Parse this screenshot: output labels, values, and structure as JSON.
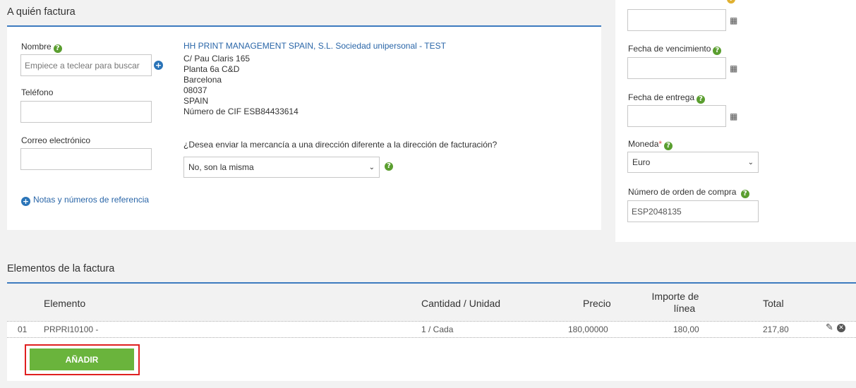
{
  "bill_to": {
    "title": "A quién factura",
    "name_label": "Nombre",
    "name_placeholder": "Empiece a teclear para buscar",
    "phone_label": "Teléfono",
    "phone_value": "",
    "email_label": "Correo electrónico",
    "email_value": "",
    "notes_link": "Notas y números de referencia",
    "company_name": "HH PRINT MANAGEMENT SPAIN, S.L. Sociedad unipersonal - TEST",
    "address_lines": [
      "C/ Pau Claris 165",
      "Planta 6a C&D",
      "Barcelona",
      "08037",
      "SPAIN",
      "Número de CIF ESB84433614"
    ],
    "ship_question": "¿Desea enviar la mercancía a una dirección diferente a la dirección de facturación?",
    "ship_selected": "No, son la misma"
  },
  "right_panel": {
    "due_date_label": "Fecha de vencimiento",
    "delivery_date_label": "Fecha de entrega",
    "currency_label": "Moneda",
    "currency_required_mark": "*",
    "currency_value": "Euro",
    "po_label": "Número de orden de compra",
    "po_value": "ESP2048135"
  },
  "items": {
    "title": "Elementos de la factura",
    "headers": {
      "element": "Elemento",
      "qty_unit": "Cantidad / Unidad",
      "price": "Precio",
      "line_amount_1": "Importe de",
      "line_amount_2": "línea",
      "total": "Total"
    },
    "rows": [
      {
        "num": "01",
        "element": "PRPRI10100 -",
        "qty_unit": "1 / Cada",
        "price": "180,00000",
        "line_amount": "180,00",
        "total": "217,80"
      }
    ],
    "add_button": "AÑADIR"
  },
  "icons": {
    "help": "question-circle-icon",
    "add": "plus-circle-icon",
    "calendar": "calendar-icon",
    "edit": "edit-icon",
    "delete": "times-circle-icon"
  },
  "colors": {
    "accent_blue": "#2a66a8",
    "panel_border": "#3d7bbf",
    "help_green": "#5a9e2f",
    "add_button_green": "#6ab43c",
    "highlight_red": "#e02020",
    "background": "#f2f2f2"
  }
}
